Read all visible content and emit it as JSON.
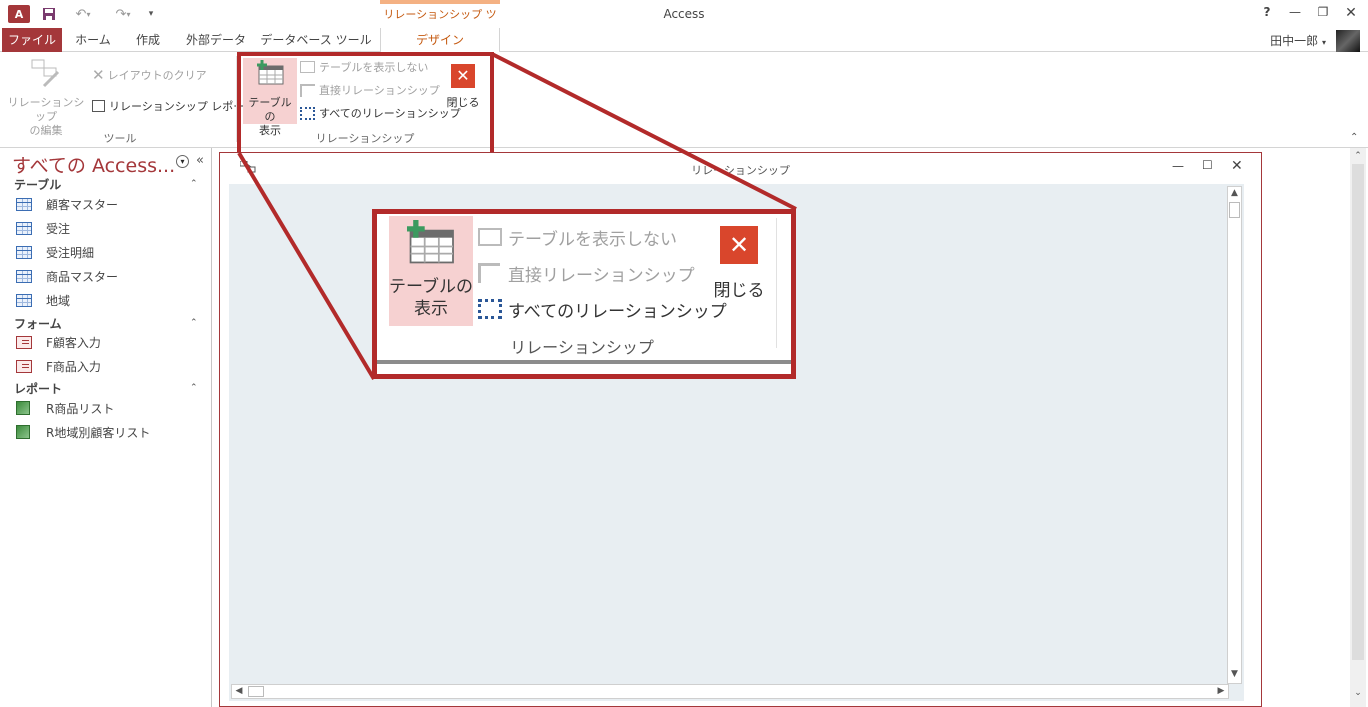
{
  "app": {
    "window_title": "Access",
    "logo_text": "A",
    "context_group": "リレーションシップ ツール",
    "help": "?",
    "user_name": "田中一郎"
  },
  "tabs": [
    "ファイル",
    "ホーム",
    "作成",
    "外部データ",
    "データベース ツール",
    "デザイン"
  ],
  "ribbon": {
    "tools_group": {
      "edit_relationships": [
        "リレーションシップ",
        "の編集"
      ],
      "clear_layout": "レイアウトのクリア",
      "relationship_report": "リレーションシップ レポート",
      "label": "ツール"
    },
    "relationships_group": {
      "show_table": [
        "テーブルの",
        "表示"
      ],
      "hide_table": "テーブルを表示しない",
      "direct_relationships": "直接リレーションシップ",
      "all_relationships": "すべてのリレーションシップ",
      "close": "閉じる",
      "label": "リレーションシップ"
    }
  },
  "nav": {
    "title": "すべての Access...",
    "collapse": "«",
    "sections": [
      {
        "header": "テーブル",
        "items": [
          "顧客マスター",
          "受注",
          "受注明細",
          "商品マスター",
          "地域"
        ]
      },
      {
        "header": "フォーム",
        "items": [
          "F顧客入力",
          "F商品入力"
        ]
      },
      {
        "header": "レポート",
        "items": [
          "R商品リスト",
          "R地域別顧客リスト"
        ]
      }
    ]
  },
  "document": {
    "title": "リレーションシップ"
  },
  "colors": {
    "accent": "#a4373a",
    "callout": "#b22a2a",
    "context_tab": "#c55a11",
    "canvas": "#e8eef2"
  }
}
